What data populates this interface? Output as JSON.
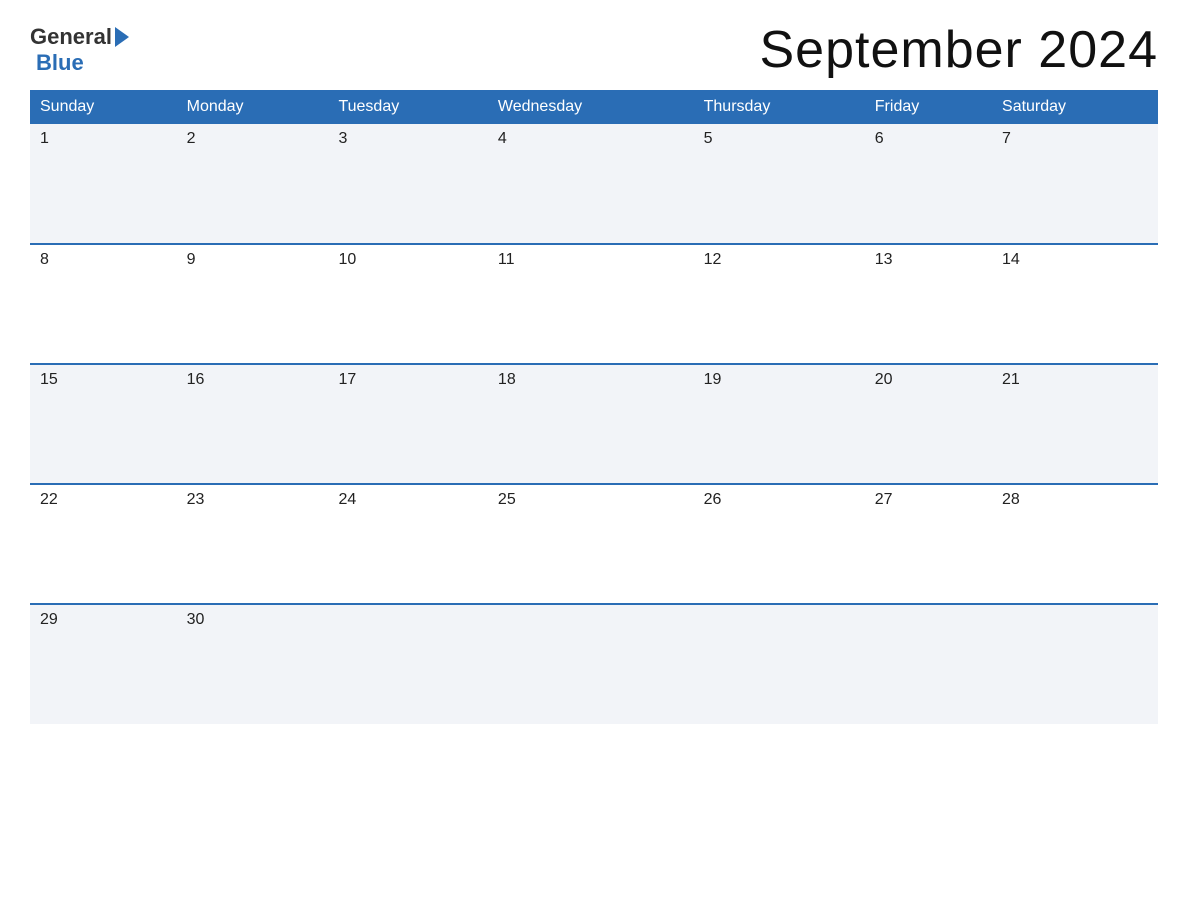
{
  "logo": {
    "general": "General",
    "blue": "Blue"
  },
  "title": "September 2024",
  "days": {
    "headers": [
      "Sunday",
      "Monday",
      "Tuesday",
      "Wednesday",
      "Thursday",
      "Friday",
      "Saturday"
    ]
  },
  "weeks": [
    [
      "1",
      "2",
      "3",
      "4",
      "5",
      "6",
      "7"
    ],
    [
      "8",
      "9",
      "10",
      "11",
      "12",
      "13",
      "14"
    ],
    [
      "15",
      "16",
      "17",
      "18",
      "19",
      "20",
      "21"
    ],
    [
      "22",
      "23",
      "24",
      "25",
      "26",
      "27",
      "28"
    ],
    [
      "29",
      "30",
      "",
      "",
      "",
      "",
      ""
    ]
  ]
}
